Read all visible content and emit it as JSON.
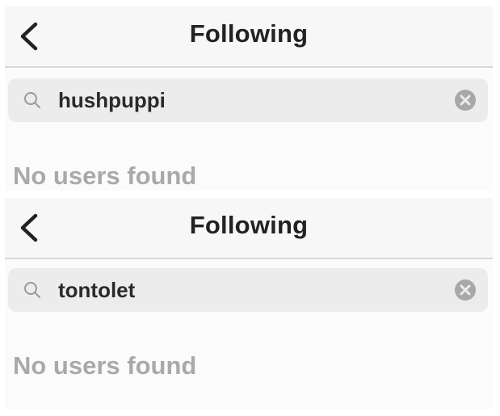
{
  "icons": {
    "back": "chevron-left-icon",
    "search": "search-icon",
    "clear": "clear-circle-icon"
  },
  "colors": {
    "title": "#222222",
    "empty_text": "#a9a9ad",
    "search_bg": "#ececec"
  },
  "panels": [
    {
      "header": {
        "title": "Following"
      },
      "search": {
        "value": "hushpuppi"
      },
      "empty_message": "No users found"
    },
    {
      "header": {
        "title": "Following"
      },
      "search": {
        "value": "tontolet"
      },
      "empty_message": "No users found"
    }
  ]
}
